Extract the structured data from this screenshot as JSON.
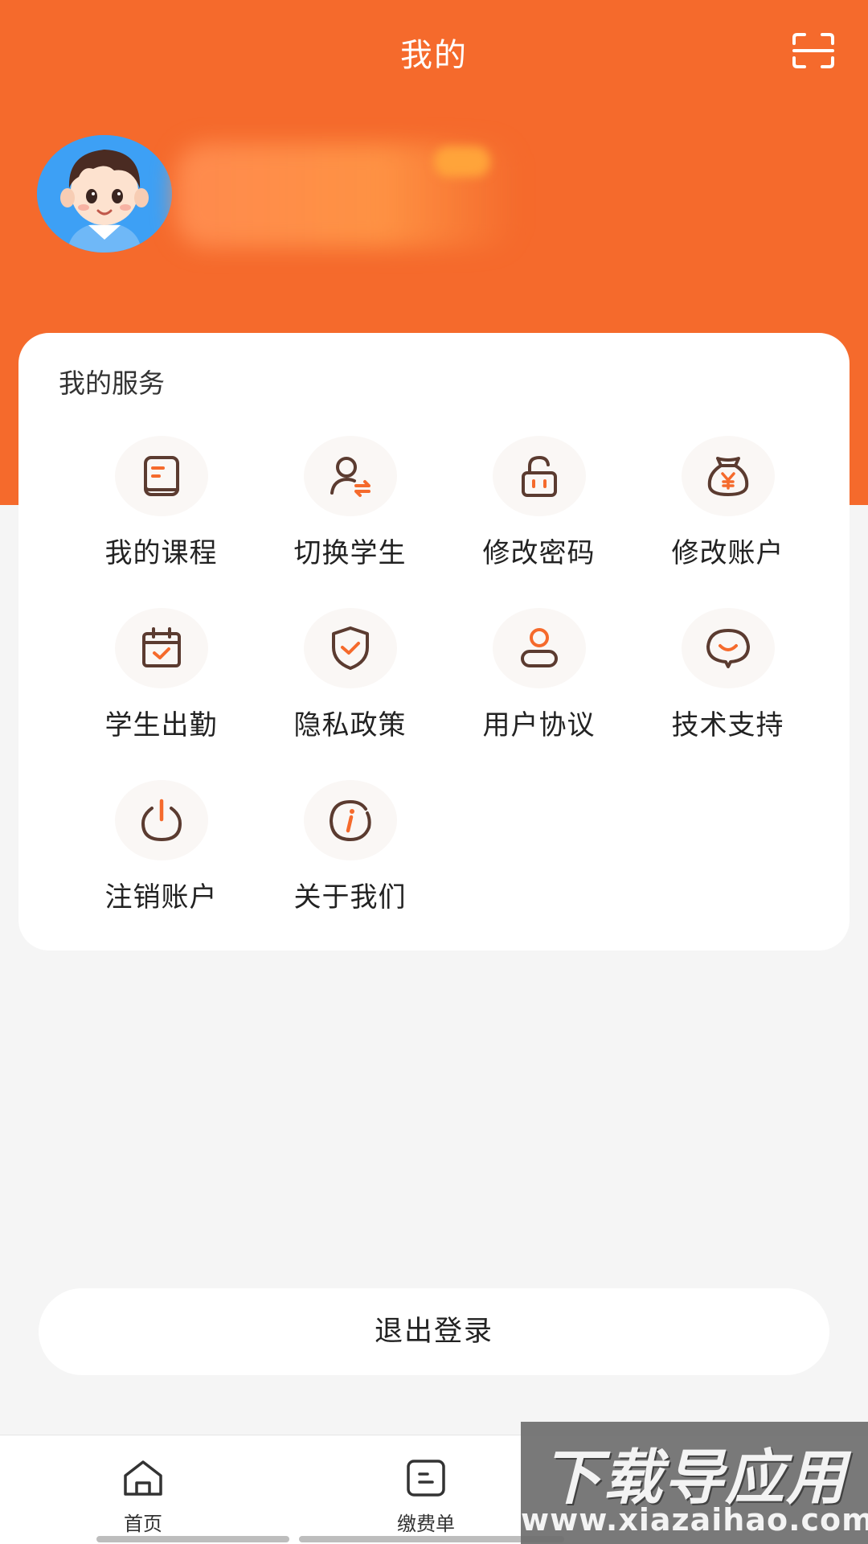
{
  "header": {
    "title": "我的"
  },
  "colors": {
    "brand": "#f56a2c",
    "icon_dark": "#5b3b30",
    "icon_accent": "#f56a2c"
  },
  "services": {
    "section_title": "我的服务",
    "items": [
      {
        "label": "我的课程",
        "icon": "book-icon"
      },
      {
        "label": "切换学生",
        "icon": "switch-user-icon"
      },
      {
        "label": "修改密码",
        "icon": "unlock-icon"
      },
      {
        "label": "修改账户",
        "icon": "money-bag-icon"
      },
      {
        "label": "学生出勤",
        "icon": "calendar-check-icon"
      },
      {
        "label": "隐私政策",
        "icon": "shield-check-icon"
      },
      {
        "label": "用户协议",
        "icon": "user-icon"
      },
      {
        "label": "技术支持",
        "icon": "chat-smile-icon"
      },
      {
        "label": "注销账户",
        "icon": "power-icon"
      },
      {
        "label": "关于我们",
        "icon": "info-icon"
      }
    ]
  },
  "logout": {
    "label": "退出登录"
  },
  "tabbar": {
    "items": [
      {
        "label": "首页",
        "icon": "home-icon"
      },
      {
        "label": "缴费单",
        "icon": "bill-icon"
      }
    ]
  },
  "watermark": {
    "line1": "下载导应用",
    "line2": "www.xiazaihao.com"
  }
}
